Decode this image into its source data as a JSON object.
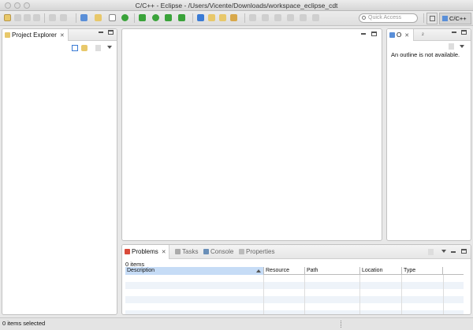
{
  "window": {
    "title": "C/C++ - Eclipse - /Users/Vicente/Downloads/workspace_eclipse_cdt"
  },
  "toolbar": {
    "quick_access_placeholder": "Quick Access",
    "perspective_label": "C/C++"
  },
  "project_explorer": {
    "tab_label": "Project Explorer",
    "close_glyph": "✕"
  },
  "outline": {
    "tab_label": "O",
    "close_glyph": "✕",
    "secondary_tab_label": "²",
    "message": "An outline is not available."
  },
  "bottom": {
    "tabs": [
      {
        "label": "Problems",
        "close_glyph": "✕"
      },
      {
        "label": "Tasks"
      },
      {
        "label": "Console"
      },
      {
        "label": "Properties"
      }
    ],
    "items_count": "0 items",
    "columns": [
      "Description",
      "Resource",
      "Path",
      "Location",
      "Type"
    ]
  },
  "status": {
    "text": "0 items selected"
  },
  "colors": {
    "accent": "#3a7bd5",
    "run_green": "#3aa33a",
    "selection_blue": "#c6dcf6"
  }
}
